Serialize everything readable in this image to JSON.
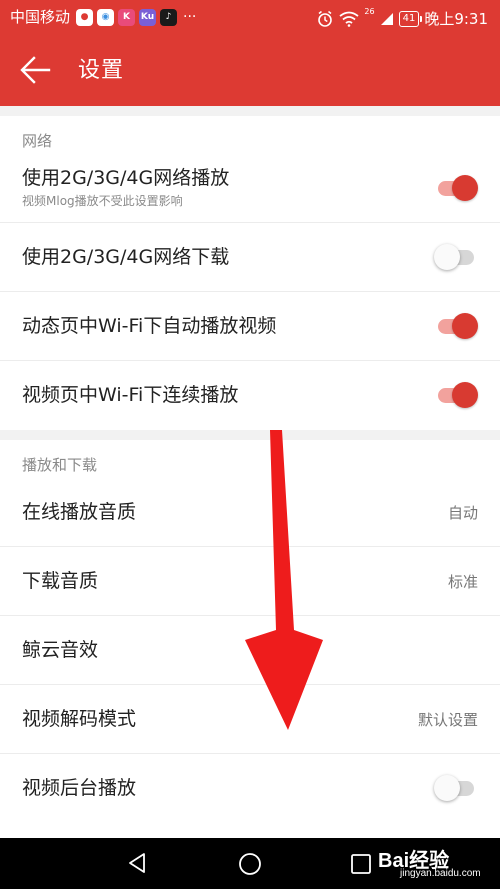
{
  "status_bar": {
    "carrier": "中国移动",
    "apps": [
      {
        "icon": "wechat-icon",
        "color": "#dd3a33",
        "glyph": "●"
      },
      {
        "icon": "browser-icon",
        "color": "#3b8fe0",
        "glyph": "◉"
      },
      {
        "icon": "kuaikan-icon",
        "color": "#e94b7a",
        "glyph": "K"
      },
      {
        "icon": "ku-icon",
        "color": "#7a5fd6",
        "glyph": "Ku"
      },
      {
        "icon": "tiktok-icon",
        "color": "#1a1a1a",
        "glyph": "♪"
      }
    ],
    "more": "···",
    "signal_label": "26",
    "battery": "41",
    "time": "晚上9:31"
  },
  "titlebar": {
    "title": "设置"
  },
  "sections": {
    "network": {
      "header": "网络",
      "items": [
        {
          "title": "使用2G/3G/4G网络播放",
          "subtitle": "视频Mlog播放不受此设置影响",
          "toggle": true
        },
        {
          "title": "使用2G/3G/4G网络下载",
          "toggle": false
        },
        {
          "title": "动态页中Wi-Fi下自动播放视频",
          "toggle": true
        },
        {
          "title": "视频页中Wi-Fi下连续播放",
          "toggle": true
        }
      ]
    },
    "playback": {
      "header": "播放和下载",
      "items": [
        {
          "title": "在线播放音质",
          "value": "自动"
        },
        {
          "title": "下载音质",
          "value": "标准"
        },
        {
          "title": "鲸云音效"
        },
        {
          "title": "视频解码模式",
          "value": "默认设置"
        },
        {
          "title": "视频后台播放",
          "toggle": false
        }
      ]
    }
  },
  "watermark": {
    "brand": "Bai经验",
    "url": "jingyan.baidu.com"
  },
  "colors": {
    "primary": "#dd3a33",
    "toggle_on_knob": "#d83a31",
    "toggle_on_track": "#f2a29d",
    "toggle_off_track": "#d7d7d7",
    "arrow": "#ee1c1c"
  }
}
